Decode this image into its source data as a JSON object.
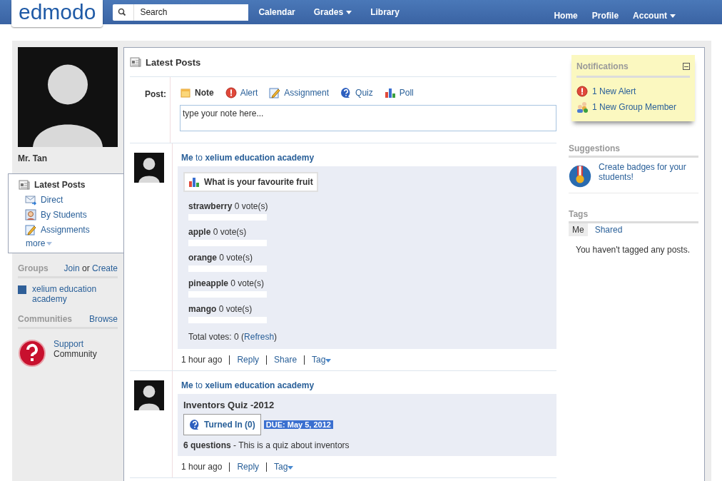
{
  "topbar": {
    "logo": "edmodo",
    "search": {
      "placeholder": "Search"
    },
    "left_links": [
      {
        "label": "Calendar",
        "dropdown": false
      },
      {
        "label": "Grades",
        "dropdown": true
      },
      {
        "label": "Library",
        "dropdown": false
      }
    ],
    "right_links": [
      {
        "label": "Home",
        "dropdown": false
      },
      {
        "label": "Profile",
        "dropdown": false
      },
      {
        "label": "Account",
        "dropdown": true
      }
    ]
  },
  "profile": {
    "name": "Mr. Tan"
  },
  "sidebar_nav": {
    "items": [
      {
        "label": "Latest Posts",
        "kind": "posts",
        "selected": true
      },
      {
        "label": "Direct",
        "kind": "mail",
        "selected": false
      },
      {
        "label": "By Students",
        "kind": "student",
        "selected": false
      },
      {
        "label": "Assignments",
        "kind": "assignment",
        "selected": false
      }
    ],
    "more": "more"
  },
  "groups": {
    "heading": "Groups",
    "join": "Join",
    "or": "or",
    "create": "Create",
    "items": [
      {
        "name": "xelium education academy",
        "color": "#2f5f98"
      }
    ]
  },
  "communities": {
    "heading": "Communities",
    "browse": "Browse",
    "items": [
      {
        "name": "Support",
        "subtitle": "Community"
      }
    ]
  },
  "feed": {
    "title": "Latest Posts",
    "composer": {
      "label": "Post:",
      "placeholder": "type your note here...",
      "types": [
        {
          "label": "Note",
          "kind": "note",
          "selected": true
        },
        {
          "label": "Alert",
          "kind": "alert",
          "selected": false
        },
        {
          "label": "Assignment",
          "kind": "assignment",
          "selected": false
        },
        {
          "label": "Quiz",
          "kind": "quiz",
          "selected": false
        },
        {
          "label": "Poll",
          "kind": "poll",
          "selected": false
        }
      ]
    },
    "posts": [
      {
        "kind": "poll",
        "author": "Me",
        "to": "to",
        "group": "xelium education academy",
        "question": "What is your favourite fruit",
        "options": [
          {
            "name": "strawberry",
            "votes": "0 vote(s)",
            "level": 0
          },
          {
            "name": "apple",
            "votes": "0 vote(s)",
            "level": 0
          },
          {
            "name": "orange",
            "votes": "0 vote(s)",
            "level": 0
          },
          {
            "name": "pineapple",
            "votes": "0 vote(s)",
            "level": 0
          },
          {
            "name": "mango",
            "votes": "0 vote(s)",
            "level": 0
          }
        ],
        "total": "Total votes: 0 (",
        "refresh": "Refresh",
        "total_end": ")",
        "time": "1 hour ago",
        "actions": [
          "Reply",
          "Share"
        ],
        "tag": "Tag"
      },
      {
        "kind": "quiz",
        "author": "Me",
        "to": "to",
        "group": "xelium education academy",
        "title": "Inventors Quiz -2012",
        "turned_in": "Turned In (0)",
        "due": "DUE: May 5, 2012",
        "questions": "6 questions",
        "description": "- This is a quiz about inventors",
        "time": "1 hour ago",
        "actions": [
          "Reply"
        ],
        "tag": "Tag"
      }
    ]
  },
  "notifications": {
    "title": "Notifications",
    "items": [
      {
        "kind": "alert",
        "label": "1 New Alert"
      },
      {
        "kind": "group",
        "label": "1 New Group Member"
      }
    ]
  },
  "suggestions": {
    "heading": "Suggestions",
    "text": "Create badges for your students!"
  },
  "tags": {
    "heading": "Tags",
    "tabs": [
      {
        "label": "Me",
        "selected": true
      },
      {
        "label": "Shared",
        "selected": false
      }
    ],
    "empty": "You haven't tagged any posts."
  }
}
